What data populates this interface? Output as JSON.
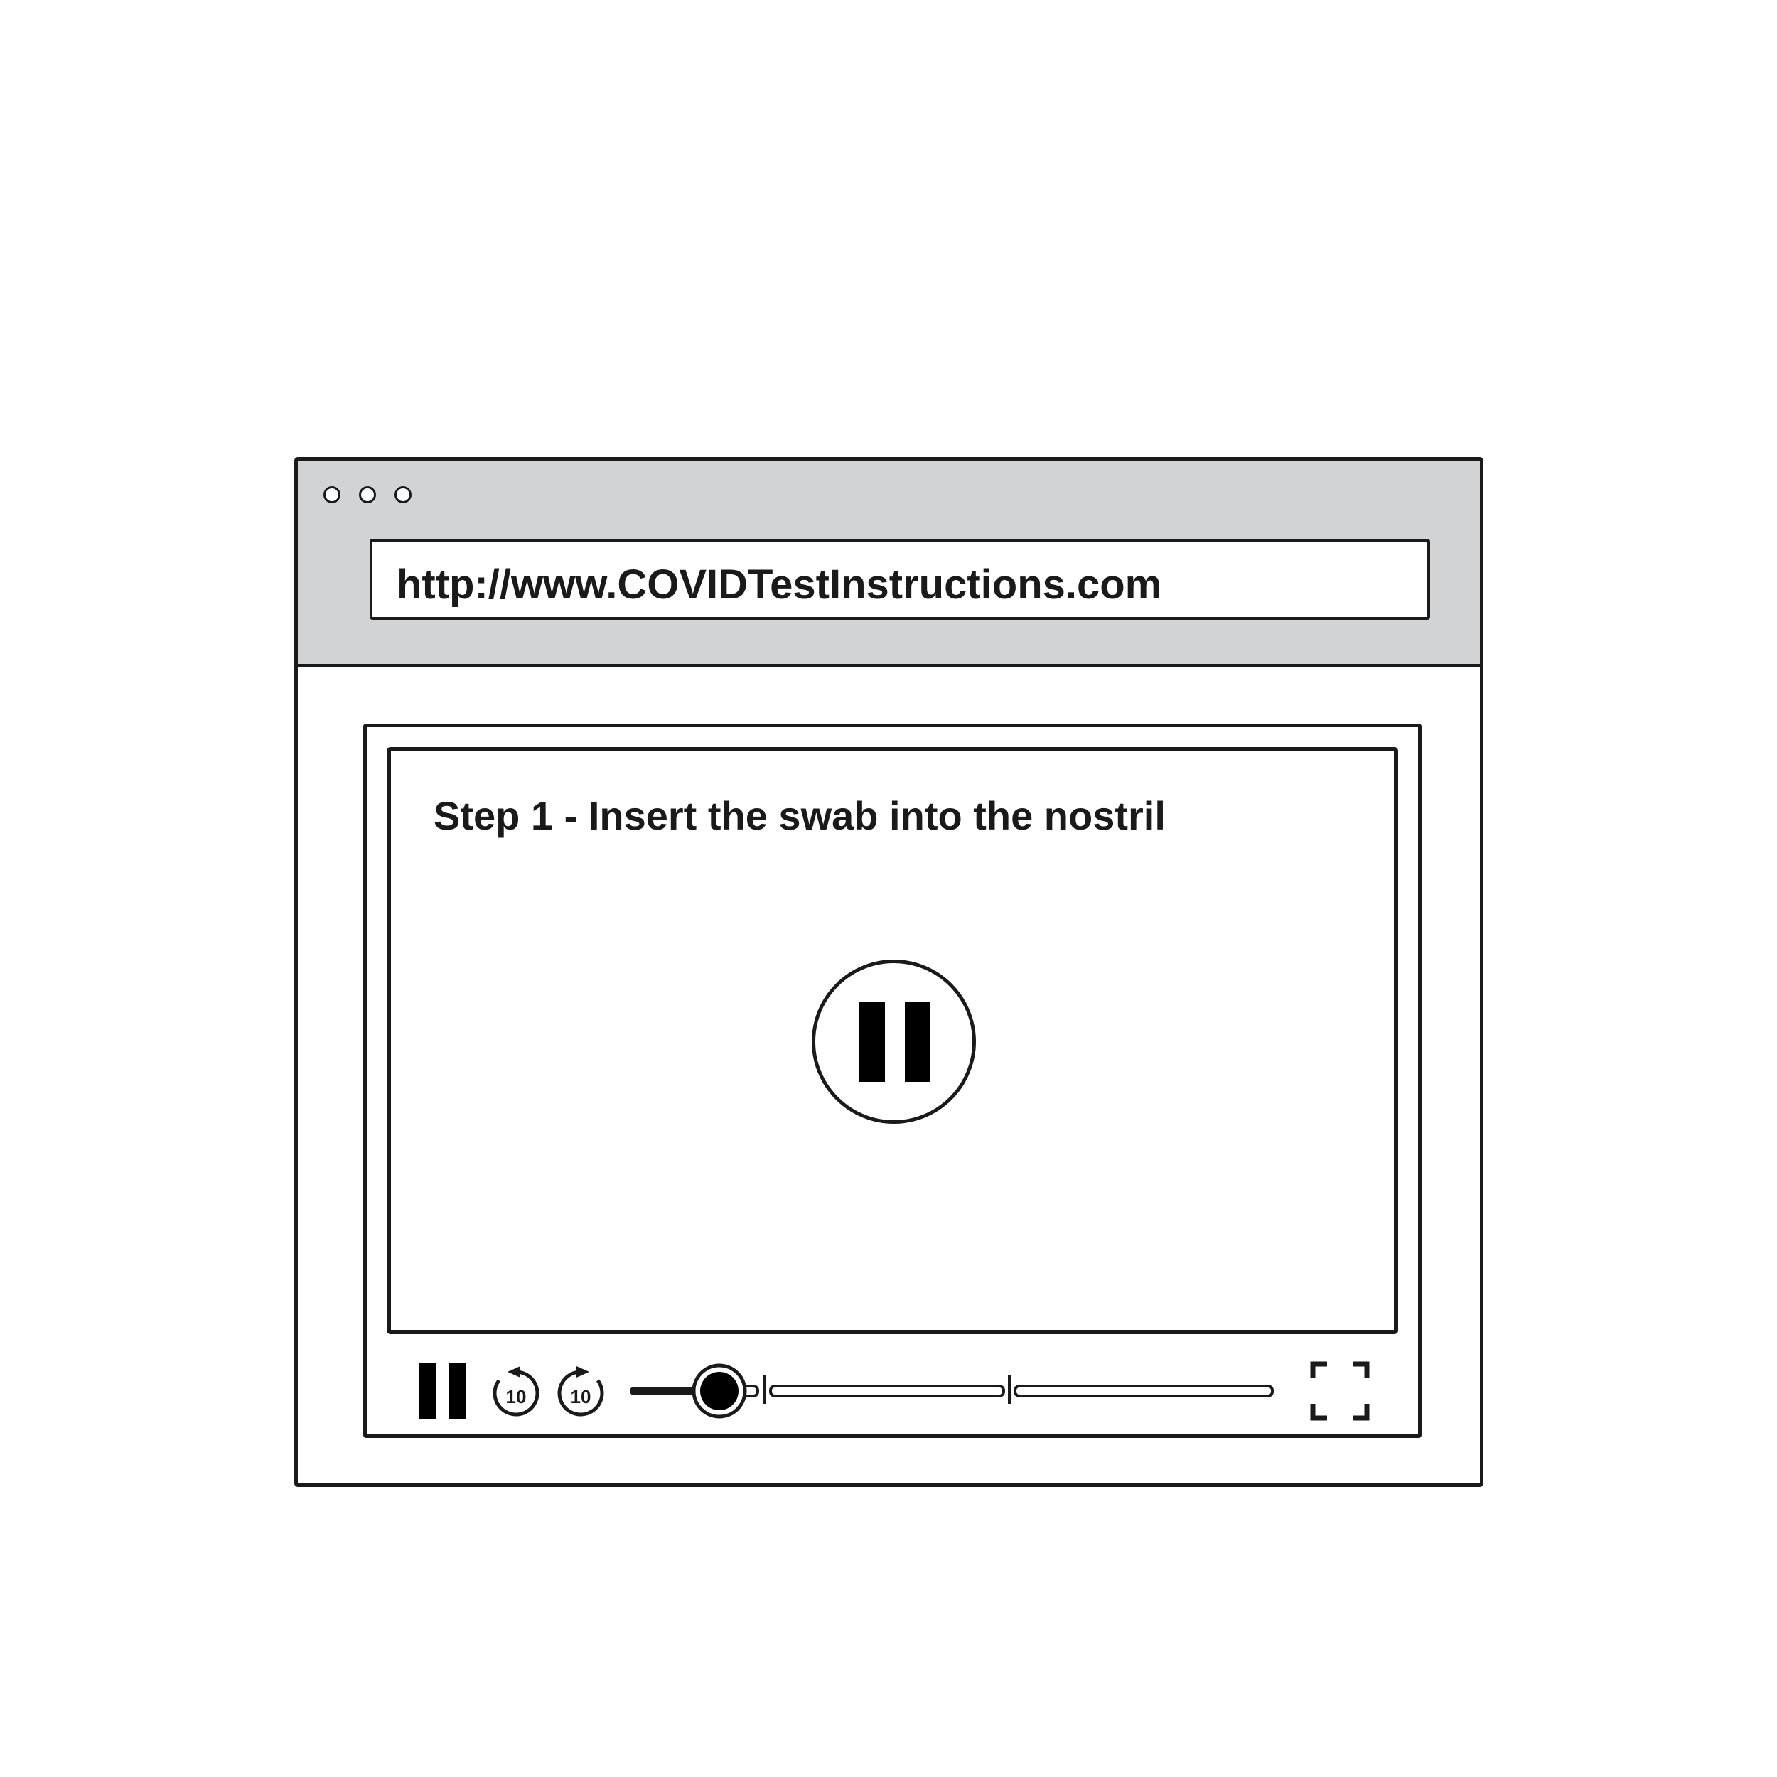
{
  "browser": {
    "url": "http://www.COVIDTestInstructions.com",
    "window_controls": [
      "window-dot",
      "window-dot",
      "window-dot"
    ]
  },
  "video": {
    "caption": "Step 1 - Insert the swab into the nostril",
    "state_icon": "pause-icon"
  },
  "controls": {
    "play_pause_icon": "pause-icon",
    "rewind_label": "10",
    "forward_label": "10",
    "fullscreen_icon": "fullscreen-icon",
    "progress_fraction": 0.11
  },
  "colors": {
    "chrome_gray": "#d1d3d4",
    "stroke": "#1a1a1a"
  }
}
